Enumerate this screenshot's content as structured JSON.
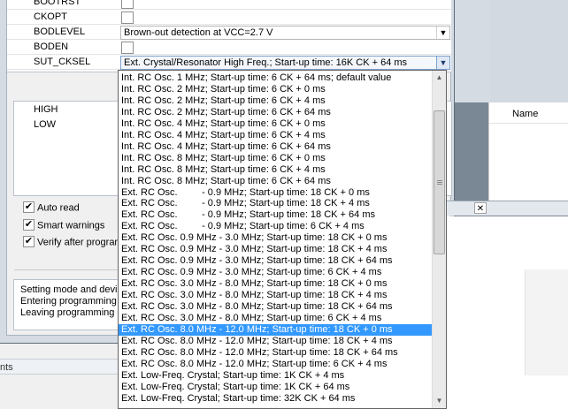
{
  "fuses": [
    {
      "name": "BOOTRST",
      "type": "checkbox",
      "checked": false
    },
    {
      "name": "CKOPT",
      "type": "checkbox",
      "checked": false
    },
    {
      "name": "BODLEVEL",
      "type": "select",
      "value": "Brown-out detection at VCC=2.7 V"
    },
    {
      "name": "BODEN",
      "type": "checkbox",
      "checked": false
    },
    {
      "name": "SUT_CKSEL",
      "type": "select",
      "value": "Ext. Crystal/Resonator High Freq.; Start-up time: 16K CK + 64 ms"
    }
  ],
  "lockbits": [
    "HIGH",
    "LOW"
  ],
  "options": [
    {
      "label": "Auto read",
      "checked": true
    },
    {
      "label": "Smart warnings",
      "checked": true
    },
    {
      "label": "Verify after programm",
      "checked": true
    }
  ],
  "log": [
    "Setting mode and device",
    "Entering programming mo",
    "Leaving programming mo"
  ],
  "dropdown": {
    "selected_index": 22,
    "options": [
      "Int. RC Osc. 1 MHz; Start-up time: 6 CK + 64 ms; default value",
      "Int. RC Osc. 2 MHz; Start-up time: 6 CK + 0 ms",
      "Int. RC Osc. 2 MHz; Start-up time: 6 CK + 4 ms",
      "Int. RC Osc. 2 MHz; Start-up time: 6 CK + 64 ms",
      "Int. RC Osc. 4 MHz; Start-up time: 6 CK + 0 ms",
      "Int. RC Osc. 4 MHz; Start-up time: 6 CK + 4 ms",
      "Int. RC Osc. 4 MHz; Start-up time: 6 CK + 64 ms",
      "Int. RC Osc. 8 MHz; Start-up time: 6 CK + 0 ms",
      "Int. RC Osc. 8 MHz; Start-up time: 6 CK + 4 ms",
      "Int. RC Osc. 8 MHz; Start-up time: 6 CK + 64 ms",
      "Ext. RC Osc.         - 0.9 MHz; Start-up time: 18 CK + 0 ms",
      "Ext. RC Osc.         - 0.9 MHz; Start-up time: 18 CK + 4 ms",
      "Ext. RC Osc.         - 0.9 MHz; Start-up time: 18 CK + 64 ms",
      "Ext. RC Osc.         - 0.9 MHz; Start-up time: 6 CK + 4 ms",
      "Ext. RC Osc. 0.9 MHz - 3.0 MHz; Start-up time: 18 CK + 0 ms",
      "Ext. RC Osc. 0.9 MHz - 3.0 MHz; Start-up time: 18 CK + 4 ms",
      "Ext. RC Osc. 0.9 MHz - 3.0 MHz; Start-up time: 18 CK + 64 ms",
      "Ext. RC Osc. 0.9 MHz - 3.0 MHz; Start-up time: 6 CK + 4 ms",
      "Ext. RC Osc. 3.0 MHz - 8.0 MHz; Start-up time: 18 CK + 0 ms",
      "Ext. RC Osc. 3.0 MHz - 8.0 MHz; Start-up time: 18 CK + 4 ms",
      "Ext. RC Osc. 3.0 MHz - 8.0 MHz; Start-up time: 18 CK + 64 ms",
      "Ext. RC Osc. 3.0 MHz - 8.0 MHz; Start-up time: 6 CK + 4 ms",
      "Ext. RC Osc. 8.0 MHz - 12.0 MHz; Start-up time: 18 CK + 0 ms",
      "Ext. RC Osc. 8.0 MHz - 12.0 MHz; Start-up time: 18 CK + 4 ms",
      "Ext. RC Osc. 8.0 MHz - 12.0 MHz; Start-up time: 18 CK + 64 ms",
      "Ext. RC Osc. 8.0 MHz - 12.0 MHz; Start-up time: 6 CK + 4 ms",
      "Ext. Low-Freq. Crystal; Start-up time: 1K CK + 4 ms",
      "Ext. Low-Freq. Crystal; Start-up time: 1K CK + 64 ms",
      "Ext. Low-Freq. Crystal; Start-up time: 32K CK + 64 ms"
    ]
  },
  "right_panel": {
    "column_header": "Name"
  },
  "status_bar": {
    "text": "nts"
  },
  "icons": {
    "dropdown_arrow": "▼",
    "scroll_up": "▲",
    "scroll_down": "▼",
    "check": "✔",
    "close": "✕"
  }
}
